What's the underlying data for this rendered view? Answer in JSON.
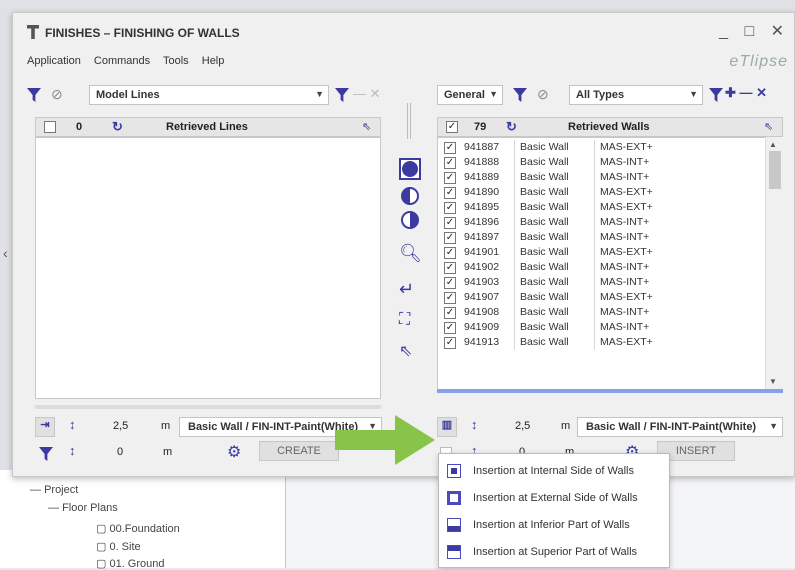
{
  "window": {
    "title": "FINISHES – FINISHING OF WALLS",
    "controls": "_ □ ✕",
    "logo": "eTlipse"
  },
  "menu": [
    "Application",
    "Commands",
    "Tools",
    "Help"
  ],
  "left": {
    "combo": "Model Lines",
    "count": "0",
    "header": "Retrieved Lines",
    "height": "2,5",
    "unit": "m",
    "type": "Basic Wall / FIN-INT-Paint(White)",
    "offset": "0",
    "unit2": "m",
    "action": "CREATE"
  },
  "right": {
    "filter1": "General",
    "filter2": "All Types",
    "count": "79",
    "header": "Retrieved Walls",
    "height": "2,5",
    "unit": "m",
    "type": "Basic Wall / FIN-INT-Paint(White)",
    "offset": "0",
    "unit2": "m",
    "action": "INSERT",
    "rows": [
      [
        "941887",
        "Basic Wall",
        "MAS-EXT+"
      ],
      [
        "941888",
        "Basic Wall",
        "MAS-INT+"
      ],
      [
        "941889",
        "Basic Wall",
        "MAS-INT+"
      ],
      [
        "941890",
        "Basic Wall",
        "MAS-EXT+"
      ],
      [
        "941895",
        "Basic Wall",
        "MAS-EXT+"
      ],
      [
        "941896",
        "Basic Wall",
        "MAS-INT+"
      ],
      [
        "941897",
        "Basic Wall",
        "MAS-INT+"
      ],
      [
        "941901",
        "Basic Wall",
        "MAS-EXT+"
      ],
      [
        "941902",
        "Basic Wall",
        "MAS-INT+"
      ],
      [
        "941903",
        "Basic Wall",
        "MAS-INT+"
      ],
      [
        "941907",
        "Basic Wall",
        "MAS-EXT+"
      ],
      [
        "941908",
        "Basic Wall",
        "MAS-INT+"
      ],
      [
        "941909",
        "Basic Wall",
        "MAS-INT+"
      ],
      [
        "941913",
        "Basic Wall",
        "MAS-EXT+"
      ]
    ]
  },
  "dropdown": [
    "Insertion at Internal Side of Walls",
    "Insertion at External Side of Walls",
    "Insertion at Inferior Part of Walls",
    "Insertion at Superior Part of Walls"
  ],
  "tree": {
    "project": "Project",
    "floorplans": "Floor Plans",
    "items": [
      "00.Foundation",
      "0. Site",
      "01. Ground"
    ]
  },
  "colors": {
    "accent": "#3a3aa0",
    "arrow": "#88c34a"
  }
}
